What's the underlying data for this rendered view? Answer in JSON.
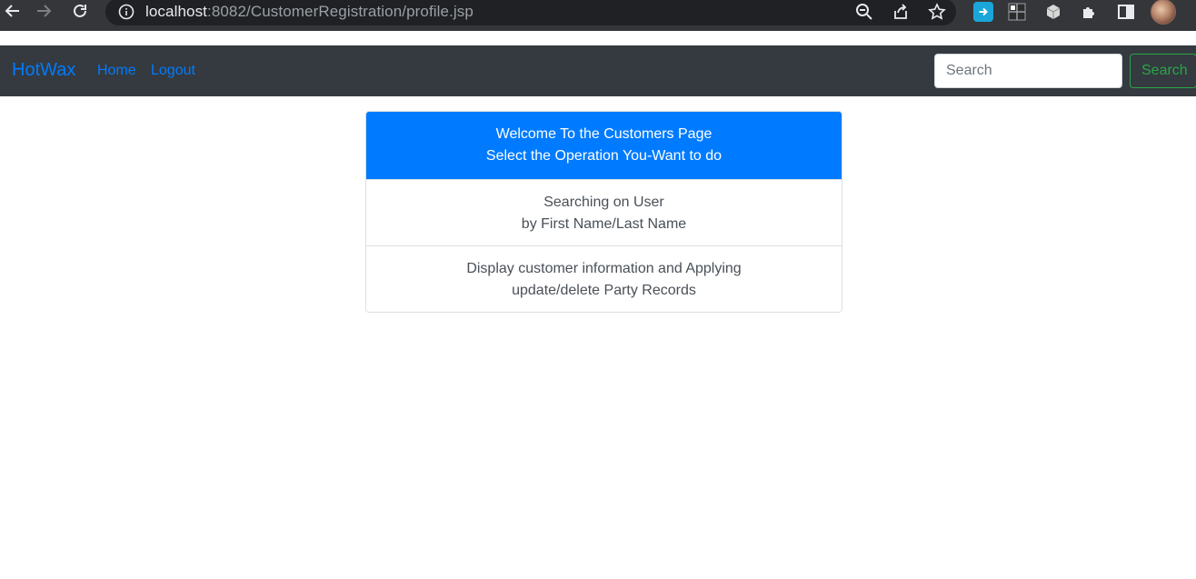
{
  "browser": {
    "url_host": "localhost",
    "url_rest": ":8082/CustomerRegistration/profile.jsp"
  },
  "navbar": {
    "brand": "HotWax",
    "links": [
      {
        "label": "Home"
      },
      {
        "label": "Logout"
      }
    ],
    "search_placeholder": "Search",
    "search_button": "Search"
  },
  "card": {
    "header_line1": "Welcome To the Customers Page",
    "header_line2": "Select the Operation You-Want to do",
    "items": [
      {
        "line1": "Searching on User",
        "line2": "by First Name/Last Name"
      },
      {
        "line1": "Display customer information and Applying",
        "line2": "update/delete Party Records"
      }
    ]
  },
  "colors": {
    "primary": "#007bff",
    "navbar_bg": "#343a40",
    "success": "#28a745"
  }
}
